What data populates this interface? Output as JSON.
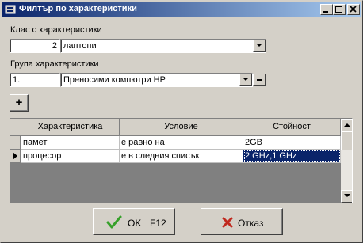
{
  "window": {
    "title": "Филтър по характеристики"
  },
  "class_group": {
    "label": "Клас с характеристики",
    "code": "2",
    "value": "лаптопи"
  },
  "product_group": {
    "label": "Група характеристики",
    "code": "1.",
    "value": "Преносими компютри HP"
  },
  "grid": {
    "columns": [
      "Характеристика",
      "Условие",
      "Стойност"
    ],
    "rows": [
      {
        "characteristic": "памет",
        "condition": "е равно на",
        "value": "2GB"
      },
      {
        "characteristic": "процесор",
        "condition": "е в следния списък",
        "value": "2 GHz,1 GHz"
      }
    ]
  },
  "buttons": {
    "add_label": "+",
    "ok_label": "OK",
    "ok_shortcut": "F12",
    "cancel_label": "Отказ"
  },
  "colors": {
    "title_gradient_start": "#0a246a",
    "selection": "#0a246a",
    "ok_check": "#36a02a",
    "cancel_x": "#c0281e"
  }
}
